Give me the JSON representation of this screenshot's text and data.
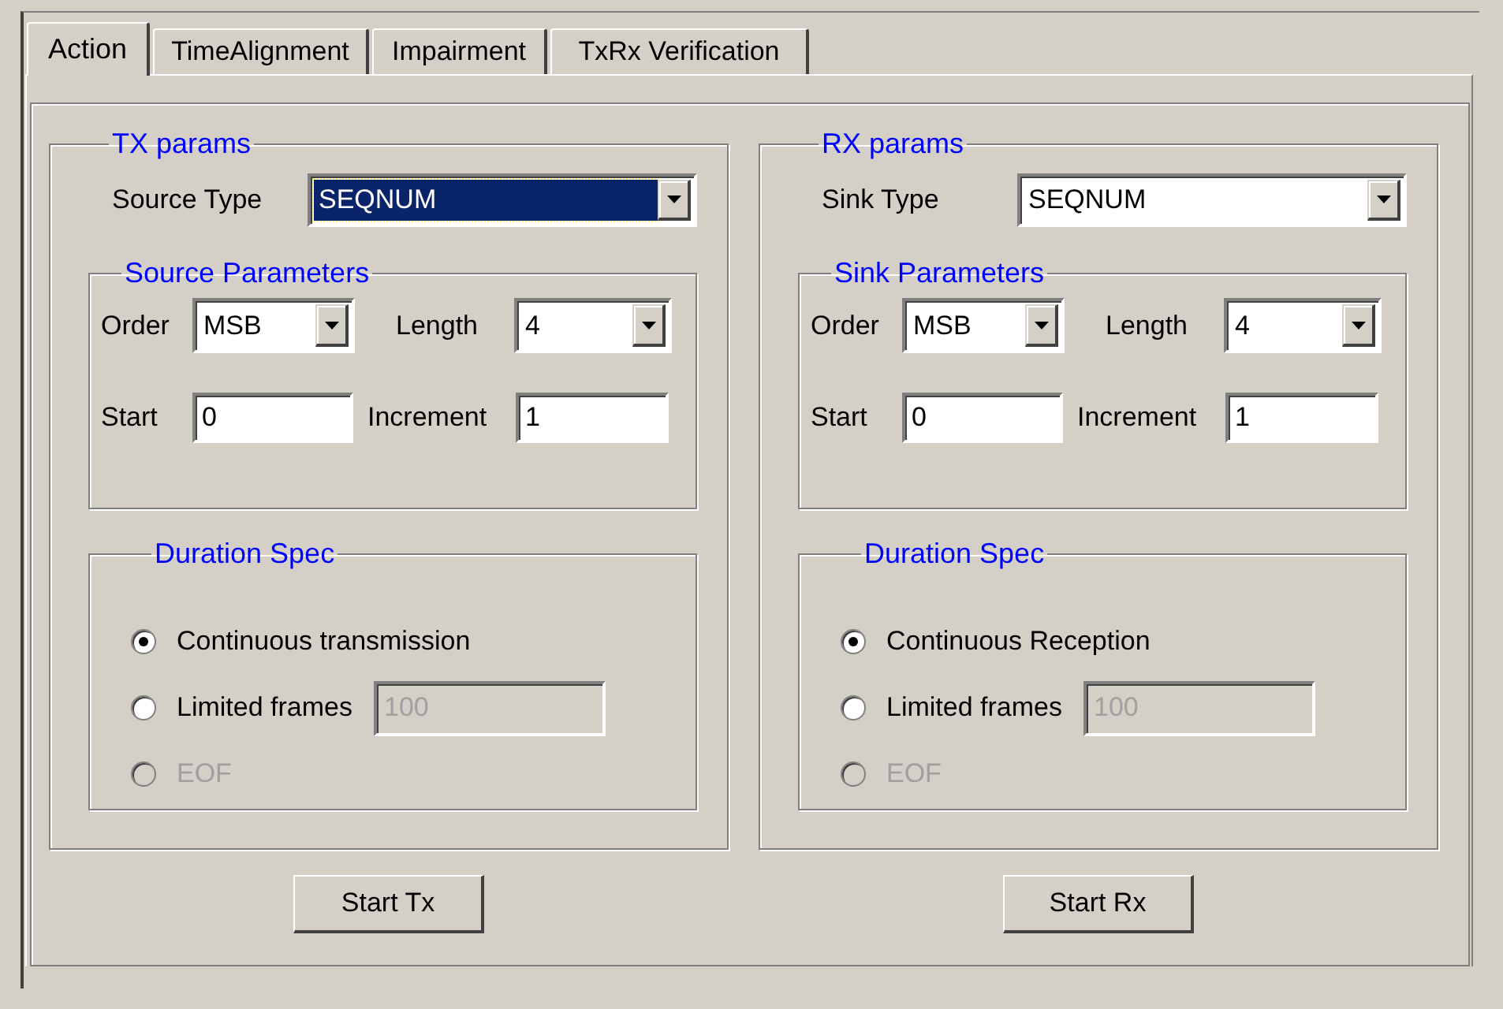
{
  "tabs": [
    {
      "label": "Action",
      "selected": true
    },
    {
      "label": "TimeAlignment",
      "selected": false
    },
    {
      "label": "Impairment",
      "selected": false
    },
    {
      "label": "TxRx Verification",
      "selected": false
    }
  ],
  "panels": [
    {
      "title": "TX params",
      "type_label": "Source Type",
      "type_value": "SEQNUM",
      "type_focused": true,
      "params_title": "Source Parameters",
      "order_label": "Order",
      "order_value": "MSB",
      "length_label": "Length",
      "length_value": "4",
      "start_label": "Start",
      "start_value": "0",
      "increment_label": "Increment",
      "increment_value": "1",
      "duration_title": "Duration Spec",
      "options": [
        {
          "label": "Continuous transmission",
          "selected": true,
          "disabled": false
        },
        {
          "label": "Limited frames",
          "selected": false,
          "disabled": false,
          "field_value": "100",
          "field_disabled": true
        },
        {
          "label": "EOF",
          "selected": false,
          "disabled": true
        }
      ],
      "button": "Start Tx"
    },
    {
      "title": "RX params",
      "type_label": "Sink Type",
      "type_value": "SEQNUM",
      "type_focused": false,
      "params_title": "Sink Parameters",
      "order_label": "Order",
      "order_value": "MSB",
      "length_label": "Length",
      "length_value": "4",
      "start_label": "Start",
      "start_value": "0",
      "increment_label": "Increment",
      "increment_value": "1",
      "duration_title": "Duration Spec",
      "options": [
        {
          "label": "Continuous Reception",
          "selected": true,
          "disabled": false
        },
        {
          "label": "Limited frames",
          "selected": false,
          "disabled": false,
          "field_value": "100",
          "field_disabled": true
        },
        {
          "label": "EOF",
          "selected": false,
          "disabled": true
        }
      ],
      "button": "Start Rx"
    }
  ]
}
